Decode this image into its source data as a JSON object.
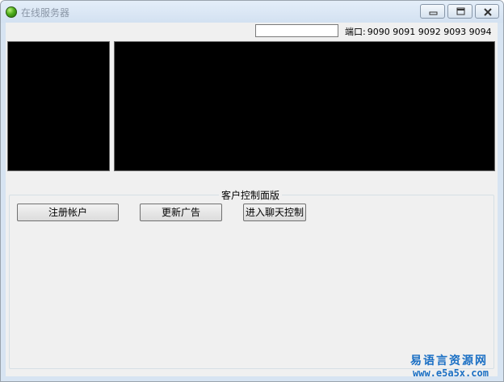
{
  "window": {
    "title": "在线服务器",
    "buttons": {
      "minimize": "minimize-icon",
      "maximize": "maximize-icon",
      "close": "close-icon"
    }
  },
  "port": {
    "input_value": "",
    "label": "端口:",
    "values": "9090 9091 9092 9093 9094"
  },
  "control_panel": {
    "title": "客户控制面版",
    "buttons": {
      "register": "注册帐户",
      "update_ad": "更新广告",
      "enter_chat": "进入聊天控制"
    }
  },
  "watermark": {
    "text": "易语言资源网",
    "url": "www.e5a5x.com"
  },
  "colors": {
    "panel_background": "#000000",
    "window_client": "#f0f0f0",
    "titlebar": "#d7e4f2",
    "watermark": "#1a6fc4"
  }
}
